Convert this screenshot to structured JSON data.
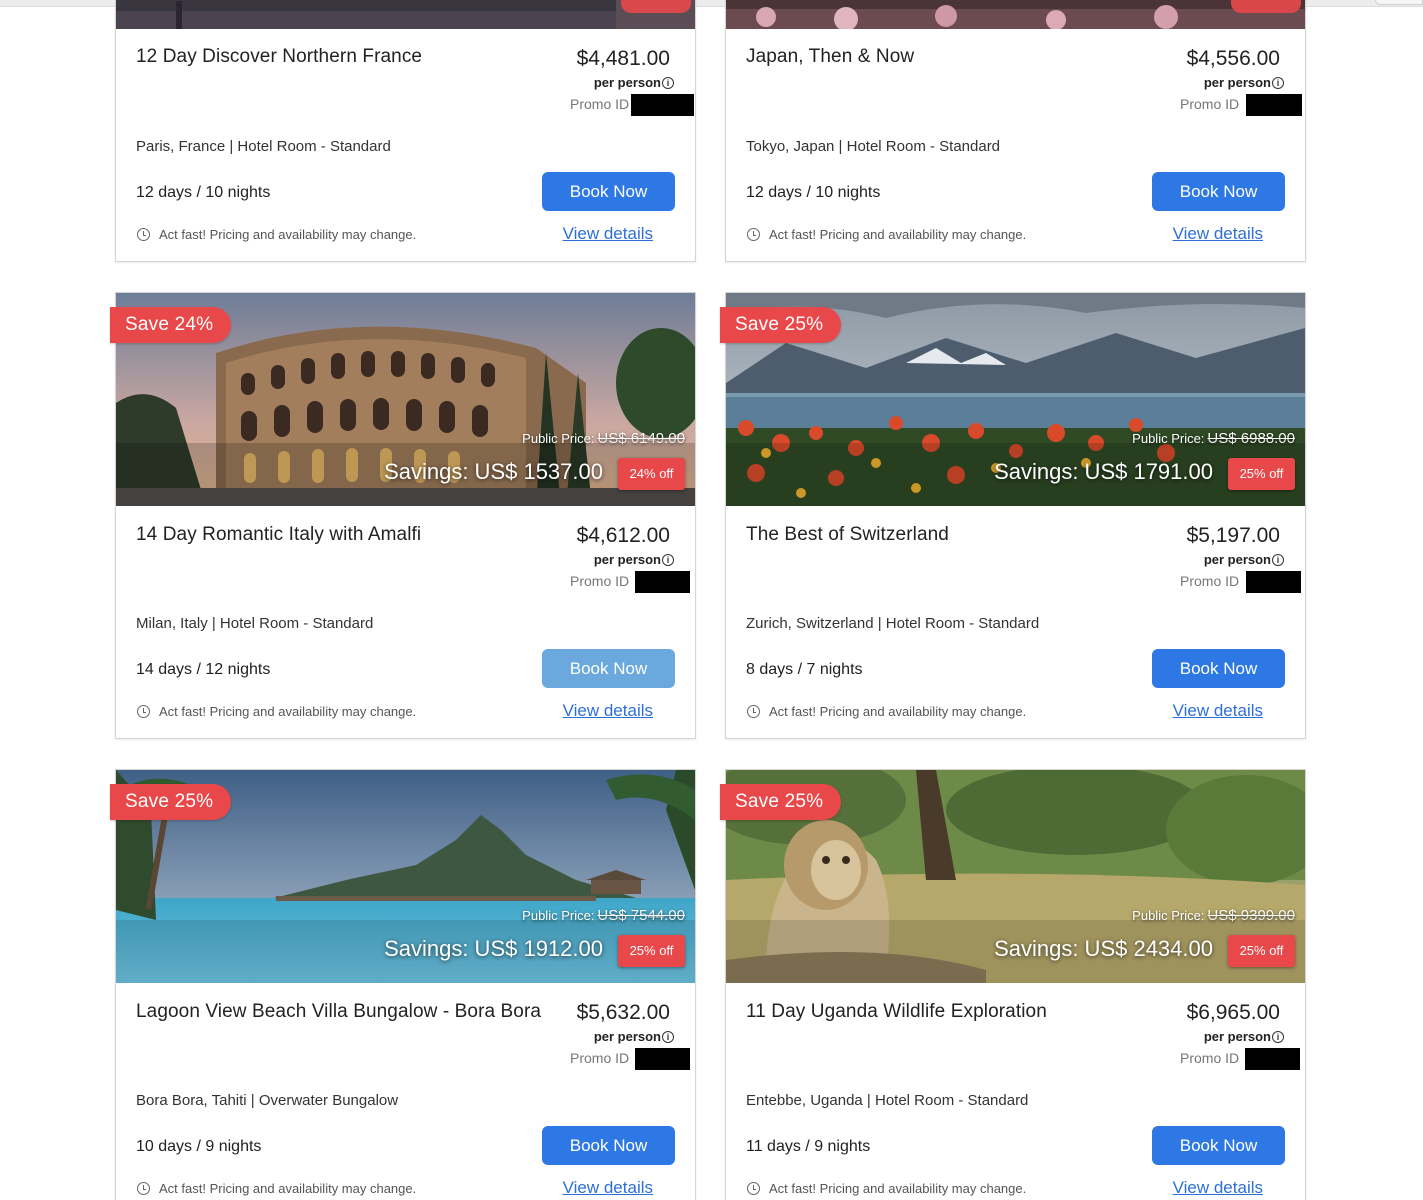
{
  "common": {
    "per_person": "per person",
    "promo_label": "Promo ID",
    "book_label": "Book Now",
    "view_details": "View details",
    "act_fast": "Act fast! Pricing and availability may change.",
    "public_price_label": "Public Price:"
  },
  "colors": {
    "accent_button": "#2d78e4",
    "button_hover": "#6aa8dd",
    "save_badge": "#e8484a",
    "link": "#2d6fd8"
  },
  "cards": [
    {
      "title": "12 Day Discover Northern France",
      "price": "$4,481.00",
      "location": "Paris, France | Hotel Room - Standard",
      "duration": "12 days / 10 nights"
    },
    {
      "title": "Japan, Then & Now",
      "price": "$4,556.00",
      "location": "Tokyo, Japan | Hotel Room - Standard",
      "duration": "12 days / 10 nights"
    },
    {
      "title": "14 Day Romantic Italy with Amalfi",
      "price": "$4,612.00",
      "location": "Milan, Italy | Hotel Room - Standard",
      "duration": "14 days / 12 nights",
      "save_badge": "Save 24%",
      "public_price": "US$ 6149.00",
      "savings": "Savings: US$ 1537.00",
      "off_badge": "24% off"
    },
    {
      "title": "The Best of Switzerland",
      "price": "$5,197.00",
      "location": "Zurich, Switzerland | Hotel Room - Standard",
      "duration": "8 days / 7 nights",
      "save_badge": "Save 25%",
      "public_price": "US$ 6988.00",
      "savings": "Savings: US$ 1791.00",
      "off_badge": "25% off"
    },
    {
      "title": "Lagoon View Beach Villa Bungalow - Bora Bora",
      "price": "$5,632.00",
      "location": "Bora Bora, Tahiti | Overwater Bungalow",
      "duration": "10 days / 9 nights",
      "save_badge": "Save 25%",
      "public_price": "US$ 7544.00",
      "savings": "Savings: US$ 1912.00",
      "off_badge": "25% off"
    },
    {
      "title": "11 Day Uganda Wildlife Exploration",
      "price": "$6,965.00",
      "location": "Entebbe, Uganda | Hotel Room - Standard",
      "duration": "11 days / 9 nights",
      "save_badge": "Save 25%",
      "public_price": "US$ 9399.00",
      "savings": "Savings: US$ 2434.00",
      "off_badge": "25% off"
    }
  ]
}
